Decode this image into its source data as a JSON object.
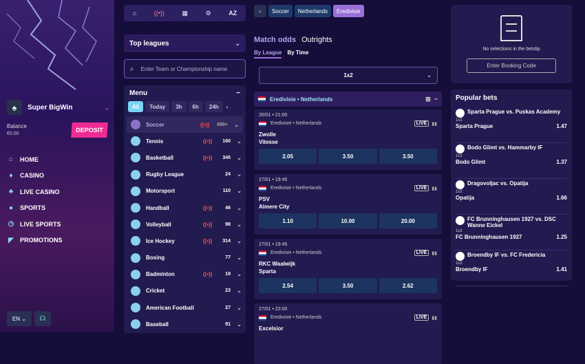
{
  "user": {
    "name": "Super BigWin",
    "balance_label": "Balance",
    "balance": "€0.00",
    "deposit": "DEPOSIT"
  },
  "nav": [
    "HOME",
    "CASINO",
    "LIVE CASINO",
    "SPORTS",
    "LIVE SPORTS",
    "PROMOTIONS"
  ],
  "footer": {
    "lang": "EN"
  },
  "topbar": {
    "az": "AZ"
  },
  "top_leagues": "Top leagues",
  "search_placeholder": "Enter Team or Championship name",
  "menu": {
    "title": "Menu",
    "filters": [
      "All",
      "Today",
      "3h",
      "6h",
      "24h"
    ]
  },
  "sports": [
    {
      "name": "Soccer",
      "live": true,
      "count": "999+"
    },
    {
      "name": "Tennis",
      "live": true,
      "count": "160"
    },
    {
      "name": "Basketball",
      "live": true,
      "count": "345"
    },
    {
      "name": "Rugby League",
      "live": false,
      "count": "24"
    },
    {
      "name": "Motorsport",
      "live": false,
      "count": "110"
    },
    {
      "name": "Handball",
      "live": true,
      "count": "46"
    },
    {
      "name": "Volleyball",
      "live": true,
      "count": "98"
    },
    {
      "name": "Ice Hockey",
      "live": true,
      "count": "314"
    },
    {
      "name": "Boxing",
      "live": false,
      "count": "77"
    },
    {
      "name": "Badminton",
      "live": true,
      "count": "19"
    },
    {
      "name": "Cricket",
      "live": false,
      "count": "23"
    },
    {
      "name": "American Football",
      "live": false,
      "count": "27"
    },
    {
      "name": "Baseball",
      "live": false,
      "count": "91"
    }
  ],
  "breadcrumb": [
    "Soccer",
    "Netherlands",
    "Eredivisie"
  ],
  "tabs": {
    "match_odds": "Match odds",
    "outrights": "Outrights",
    "by_league": "By League",
    "by_time": "By Time"
  },
  "market": "1x2",
  "league": "Eredivisie • Netherlands",
  "matches": [
    {
      "time": "26/01 • 21:00",
      "league": "Eredivisie • Netherlands",
      "live": "LIVE",
      "home": "Zwolle",
      "away": "Vitesse",
      "odds": [
        "2.05",
        "3.50",
        "3.50"
      ]
    },
    {
      "time": "27/01 • 19:45",
      "league": "Eredivisie • Netherlands",
      "live": "LIVE",
      "home": "PSV",
      "away": "Almere City",
      "odds": [
        "1.10",
        "10.00",
        "20.00"
      ]
    },
    {
      "time": "27/01 • 19:45",
      "league": "Eredivisie • Netherlands",
      "live": "LIVE",
      "home": "RKC Waalwijk",
      "away": "Sparta",
      "odds": [
        "2.54",
        "3.50",
        "2.62"
      ]
    },
    {
      "time": "27/01 • 22:00",
      "league": "Eredivisie • Netherlands",
      "live": "LIVE",
      "home": "Excelsior",
      "away": "",
      "odds": []
    }
  ],
  "betslip": {
    "empty": "No selections in the betslip",
    "booking": "Enter Booking Code"
  },
  "popular": {
    "title": "Popular bets",
    "items": [
      {
        "match": "Sparta Prague vs. Puskas Academy",
        "market": "1x2",
        "pick": "Sparta Prague",
        "odd": "1.47"
      },
      {
        "match": "Bodo Glimt vs. Hammarby IF",
        "market": "1x2",
        "pick": "Bodo Glimt",
        "odd": "1.37"
      },
      {
        "match": "Dragovoljac vs. Opatija",
        "market": "1x2",
        "pick": "Opatija",
        "odd": "1.66"
      },
      {
        "match": "FC Brunninghausen 1927 vs. DSC Wanne Eickel",
        "market": "1x2",
        "pick": "FC Brunninghausen 1927",
        "odd": "1.25"
      },
      {
        "match": "Broendby IF vs. FC Fredericia",
        "market": "1x2",
        "pick": "Broendby IF",
        "odd": "1.41"
      }
    ]
  }
}
